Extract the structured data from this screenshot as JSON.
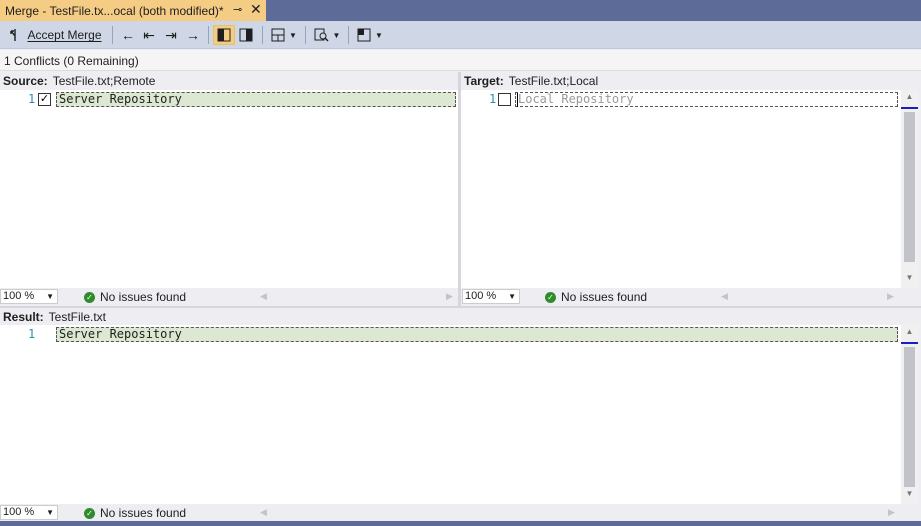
{
  "tab": {
    "title": "Merge - TestFile.tx...ocal (both modified)*",
    "pin": "⊸",
    "close": "✕"
  },
  "toolbar": {
    "accept_label": "Accept Merge",
    "accept_icon": "merge-icon"
  },
  "conflicts": {
    "text": "1 Conflicts (0 Remaining)"
  },
  "source": {
    "label": "Source:",
    "file": "TestFile.txt;Remote",
    "lines": [
      {
        "no": "1",
        "text": "Server Repository",
        "checked": "✓"
      }
    ],
    "zoom": "100 %",
    "status": "No issues found"
  },
  "target": {
    "label": "Target:",
    "file": "TestFile.txt;Local",
    "lines": [
      {
        "no": "1",
        "text": "Local Repository",
        "checked": ""
      }
    ],
    "zoom": "100 %",
    "status": "No issues found"
  },
  "result": {
    "label": "Result:",
    "file": "TestFile.txt",
    "lines": [
      {
        "no": "1",
        "text": "Server Repository"
      }
    ],
    "zoom": "100 %",
    "status": "No issues found"
  },
  "colors": {
    "tab_active": "#f5cc84",
    "accent": "#5d6b99",
    "changed_line": "#dde8d2",
    "ok": "#2e8b2e"
  }
}
